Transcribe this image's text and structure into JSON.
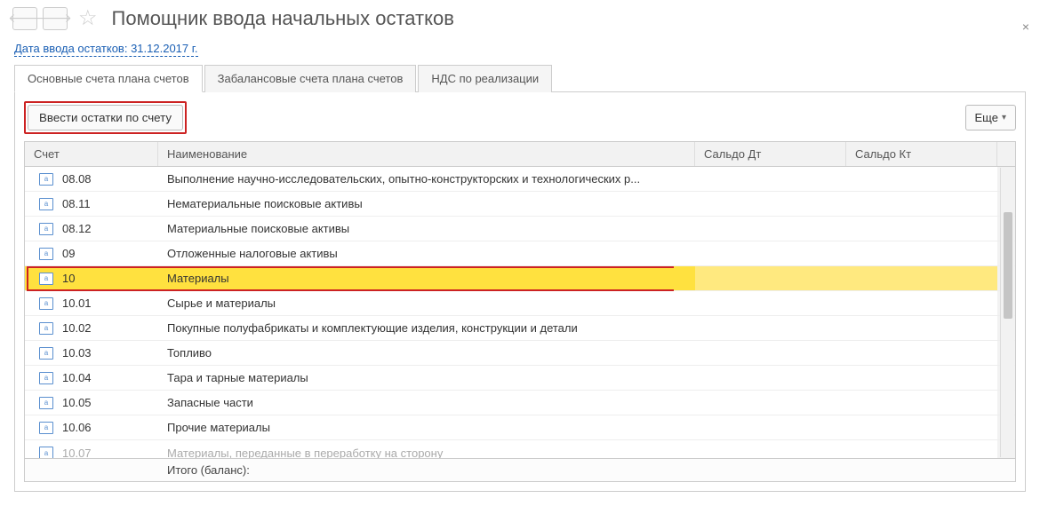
{
  "header": {
    "title": "Помощник ввода начальных остатков",
    "close": "×"
  },
  "date_link": "Дата ввода остатков: 31.12.2017 г.",
  "tabs": [
    {
      "label": "Основные счета плана счетов",
      "active": true
    },
    {
      "label": "Забалансовые счета плана счетов",
      "active": false
    },
    {
      "label": "НДС по реализации",
      "active": false
    }
  ],
  "toolbar": {
    "enter_balance_label": "Ввести остатки по счету",
    "more_label": "Еще"
  },
  "columns": {
    "account": "Счет",
    "name": "Наименование",
    "saldo_dt": "Сальдо Дт",
    "saldo_kt": "Сальдо Кт"
  },
  "rows": [
    {
      "code": "08.08",
      "name": "Выполнение научно-исследовательских, опытно-конструкторских и технологических р...",
      "selected": false
    },
    {
      "code": "08.11",
      "name": "Нематериальные поисковые активы",
      "selected": false
    },
    {
      "code": "08.12",
      "name": "Материальные поисковые активы",
      "selected": false
    },
    {
      "code": "09",
      "name": "Отложенные налоговые активы",
      "selected": false
    },
    {
      "code": "10",
      "name": "Материалы",
      "selected": true
    },
    {
      "code": "10.01",
      "name": "Сырье и материалы",
      "selected": false
    },
    {
      "code": "10.02",
      "name": "Покупные полуфабрикаты и комплектующие изделия, конструкции и детали",
      "selected": false
    },
    {
      "code": "10.03",
      "name": "Топливо",
      "selected": false
    },
    {
      "code": "10.04",
      "name": "Тара и тарные материалы",
      "selected": false
    },
    {
      "code": "10.05",
      "name": "Запасные части",
      "selected": false
    },
    {
      "code": "10.06",
      "name": "Прочие материалы",
      "selected": false
    },
    {
      "code": "10.07",
      "name": "Материалы, переданные в переработку на сторону",
      "selected": false,
      "cutoff": true
    }
  ],
  "footer": {
    "total_label": "Итого (баланс):"
  },
  "icons": {
    "acc_letter": "а"
  }
}
